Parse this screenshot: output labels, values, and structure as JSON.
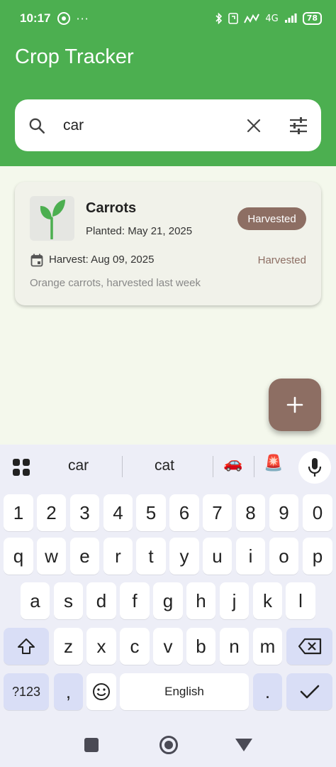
{
  "status_bar": {
    "time": "10:17",
    "dots": "···",
    "network": "4G",
    "battery": "78"
  },
  "app": {
    "title": "Crop Tracker",
    "colors": {
      "primary": "#4caf50",
      "accent": "#8d6e63",
      "background": "#f4f8ec"
    }
  },
  "search": {
    "value": "car",
    "icon": "search-icon",
    "clear_icon": "close-icon",
    "filter_icon": "tune-icon"
  },
  "crops": [
    {
      "name": "Carrots",
      "planted": "Planted: May 21, 2025",
      "badge": "Harvested",
      "harvest": "Harvest: Aug 09, 2025",
      "status": "Harvested",
      "notes": "Orange carrots, harvested last week",
      "icon": "sprout-icon"
    }
  ],
  "fab": {
    "label": "+"
  },
  "keyboard": {
    "suggestions": [
      "car",
      "cat"
    ],
    "emoji_suggestions": [
      "🚗",
      "🚨"
    ],
    "row_numbers": [
      "1",
      "2",
      "3",
      "4",
      "5",
      "6",
      "7",
      "8",
      "9",
      "0"
    ],
    "row_1": [
      "q",
      "w",
      "e",
      "r",
      "t",
      "y",
      "u",
      "i",
      "o",
      "p"
    ],
    "row_2": [
      "a",
      "s",
      "d",
      "f",
      "g",
      "h",
      "j",
      "k",
      "l"
    ],
    "row_3": [
      "z",
      "x",
      "c",
      "v",
      "b",
      "n",
      "m"
    ],
    "symbols_key": "?123",
    "comma_key": ",",
    "space_key": "English",
    "period_key": "."
  }
}
